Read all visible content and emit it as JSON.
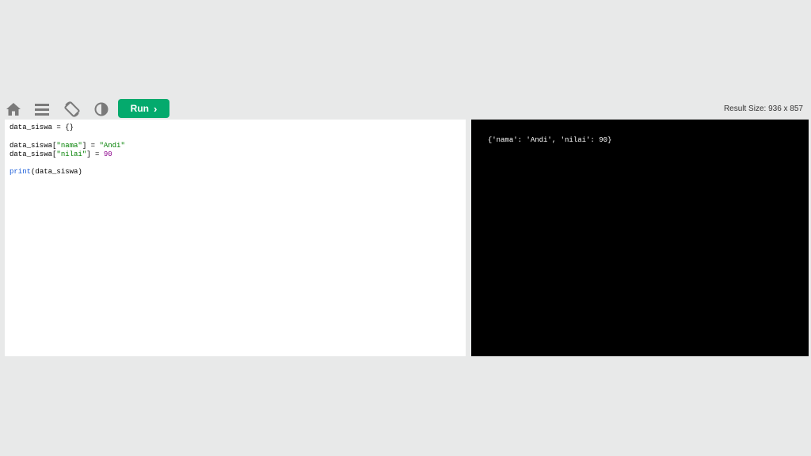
{
  "toolbar": {
    "icons": {
      "home": "home-icon",
      "menu": "menu-icon",
      "rotate": "rotate-icon",
      "theme": "contrast-icon"
    },
    "run_label": "Run",
    "result_size": "Result Size: 936 x 857"
  },
  "editor": {
    "lines": [
      {
        "tokens": [
          {
            "text": "data_siswa = {}",
            "kind": "plain"
          }
        ]
      },
      {
        "tokens": []
      },
      {
        "tokens": [
          {
            "text": "data_siswa[",
            "kind": "plain"
          },
          {
            "text": "\"nama\"",
            "kind": "string"
          },
          {
            "text": "] = ",
            "kind": "plain"
          },
          {
            "text": "\"Andi\"",
            "kind": "string"
          }
        ]
      },
      {
        "tokens": [
          {
            "text": "data_siswa[",
            "kind": "plain"
          },
          {
            "text": "\"nilai\"",
            "kind": "string"
          },
          {
            "text": "] = ",
            "kind": "plain"
          },
          {
            "text": "90",
            "kind": "number"
          }
        ]
      },
      {
        "tokens": []
      },
      {
        "tokens": [
          {
            "text": "print",
            "kind": "function"
          },
          {
            "text": "(data_siswa)",
            "kind": "plain"
          }
        ]
      }
    ]
  },
  "output": {
    "text": "{'nama': 'Andi', 'nilai': 90}"
  },
  "colors": {
    "background": "#e8e9e9",
    "run_button": "#04aa6d",
    "string": "#008000",
    "number": "#8b008b",
    "function": "#1a5cd8",
    "output_bg": "#000000",
    "output_text": "#ffffff"
  }
}
